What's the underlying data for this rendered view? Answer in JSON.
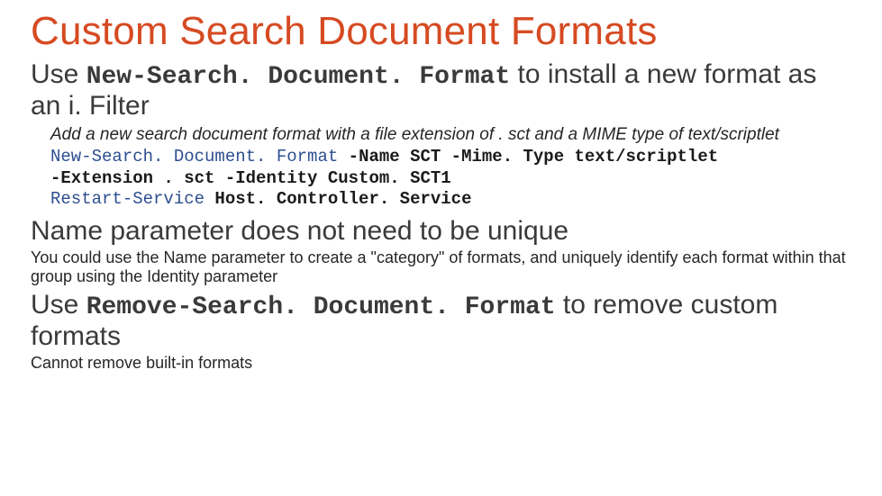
{
  "title": "Custom Search Document Formats",
  "sub1": {
    "pre": "Use ",
    "cmd": "New-Search. Document. Format",
    "post": " to install a new format as an i. Filter"
  },
  "note1": "Add a new search document format with a file extension of . sct and a MIME type of text/scriptlet",
  "code": {
    "kw1": "New-Search. Document. Format",
    "line1_rest": " -Name SCT -Mime. Type text/scriptlet",
    "line2": "-Extension . sct -Identity Custom. SCT1",
    "kw2": "Restart-Service",
    "line3_rest": " Host. Controller. Service"
  },
  "sub2": "Name parameter does not need to be unique",
  "note2": "You could use the Name parameter to create a \"category\" of formats, and uniquely identify each format within that group using the Identity parameter",
  "sub3": {
    "pre": "Use ",
    "cmd": "Remove-Search. Document. Format",
    "post": " to remove custom formats"
  },
  "note3": "Cannot remove built-in formats"
}
